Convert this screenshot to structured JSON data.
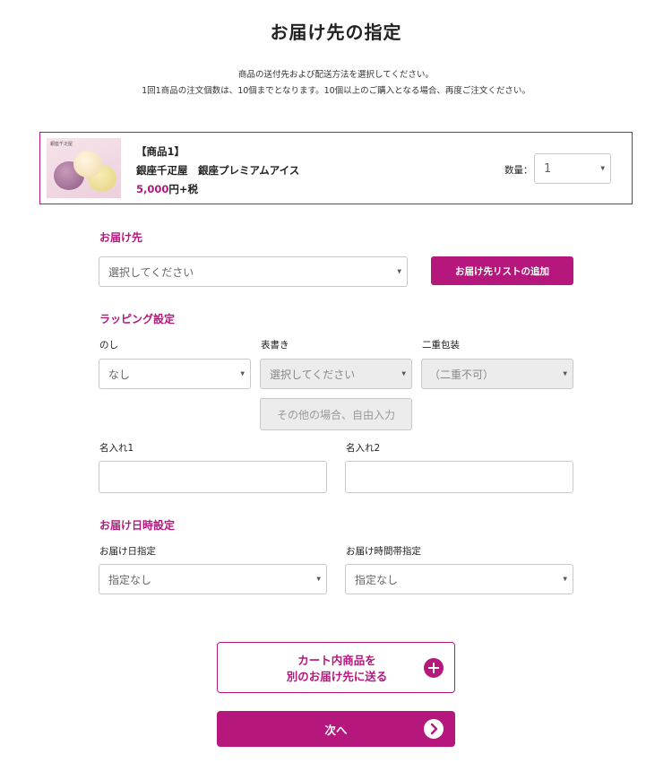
{
  "page": {
    "title": "お届け先の指定",
    "intro_line1": "商品の送付先および配送方法を選択してください。",
    "intro_line2": "1回1商品の注文個数は、10個までとなります。10個以上のご購入となる場合、再度ご注文ください。"
  },
  "product": {
    "tag": "【商品1】",
    "name": "銀座千疋屋　銀座プレミアムアイス",
    "price_value": "5,000",
    "price_suffix": "円+税",
    "image_label": "銀座千疋屋",
    "qty_label": "数量：",
    "qty_value": "1"
  },
  "destination": {
    "heading": "お届け先",
    "select_value": "選択してください",
    "add_button": "お届け先リストの追加"
  },
  "wrapping": {
    "heading": "ラッピング設定",
    "noshi_label": "のし",
    "noshi_value": "なし",
    "omote_label": "表書き",
    "omote_value": "選択してください",
    "double_label": "二重包装",
    "double_value": "（二重不可）",
    "free_input_button": "その他の場合、自由入力",
    "name1_label": "名入れ1",
    "name2_label": "名入れ2"
  },
  "delivery": {
    "heading": "お届け日時設定",
    "date_label": "お届け日指定",
    "date_value": "指定なし",
    "time_label": "お届け時間帯指定",
    "time_value": "指定なし"
  },
  "actions": {
    "send_other_line1": "カート内商品を",
    "send_other_line2": "別のお届け先に送る",
    "next": "次へ"
  },
  "colors": {
    "accent": "#b5177d",
    "border": "#c8c8c8",
    "disabled_bg": "#ececec"
  },
  "icons": {
    "select_arrow": "triangle-down",
    "plus": "circle-plus",
    "next": "circle-chevron-right"
  }
}
